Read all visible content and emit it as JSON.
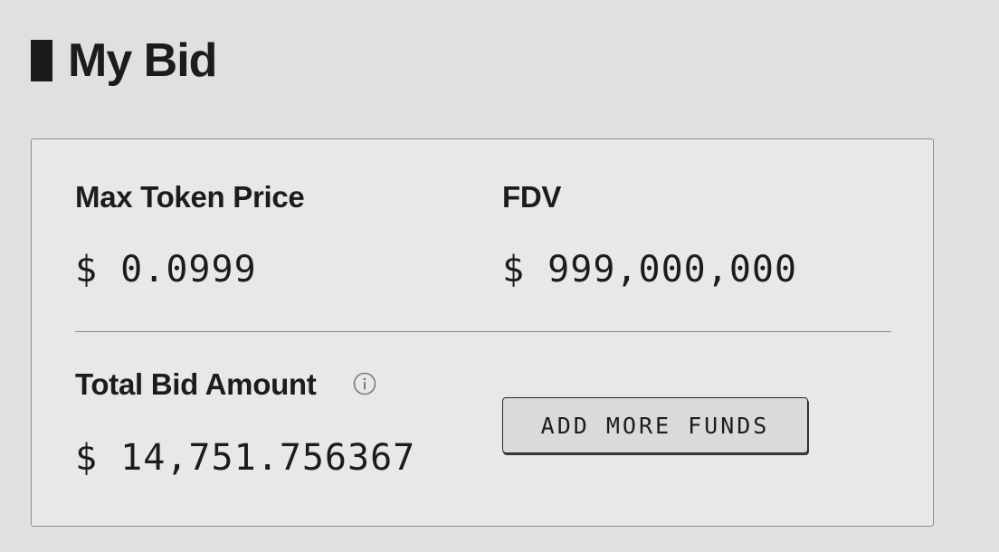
{
  "section": {
    "title": "My Bid"
  },
  "bid": {
    "max_token_price": {
      "label": "Max Token Price",
      "value": "$ 0.0999"
    },
    "fdv": {
      "label": "FDV",
      "value": "$ 999,000,000"
    },
    "total_bid_amount": {
      "label": "Total Bid Amount",
      "value": "$ 14,751.756367",
      "info_icon": "info-circle-icon"
    },
    "add_funds_button": {
      "label": "ADD MORE FUNDS"
    }
  },
  "colors": {
    "page_background": "#e1e0df",
    "card_background": "#e9e8e6",
    "text": "#1c1c1c",
    "accent_bar": "#1a1a1a",
    "button_background": "#dcdad8"
  }
}
